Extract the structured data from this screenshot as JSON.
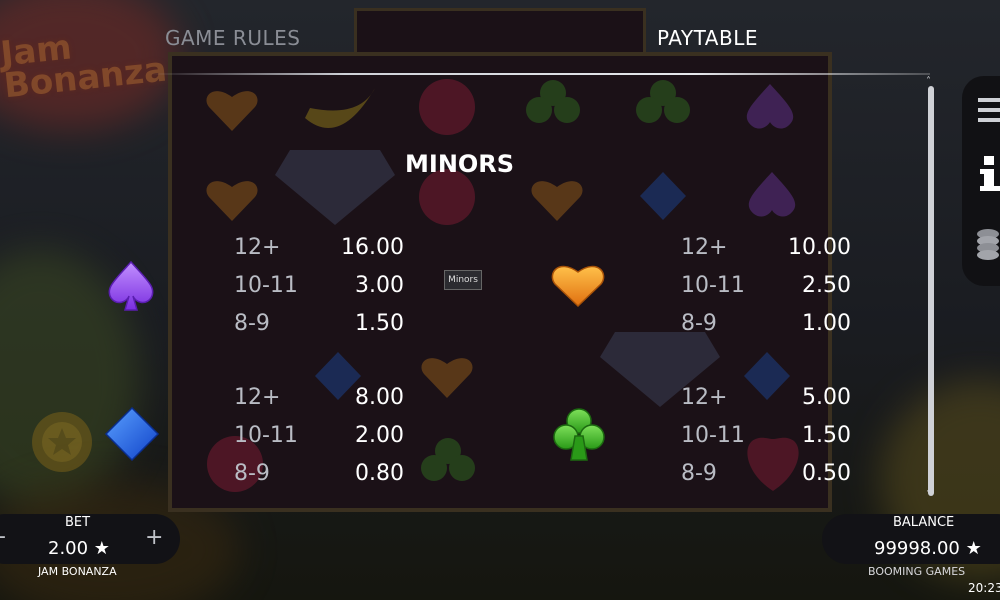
{
  "game": {
    "logo_text": "Jam Bonanza"
  },
  "tabs": [
    {
      "label": "GAME RULES",
      "active": false
    },
    {
      "label": "PAYTABLE",
      "active": true
    }
  ],
  "section": {
    "title": "MINORS",
    "tooltip": "Minors"
  },
  "paytable": [
    {
      "symbol": "spade-icon",
      "color": "#9b4ff0",
      "rows": [
        {
          "count": "12+",
          "value": "16.00"
        },
        {
          "count": "10-11",
          "value": "3.00"
        },
        {
          "count": "8-9",
          "value": "1.50"
        }
      ]
    },
    {
      "symbol": "heart-icon",
      "color": "#f59a1c",
      "rows": [
        {
          "count": "12+",
          "value": "10.00"
        },
        {
          "count": "10-11",
          "value": "2.50"
        },
        {
          "count": "8-9",
          "value": "1.00"
        }
      ]
    },
    {
      "symbol": "diamond-icon",
      "color": "#1e6cf0",
      "rows": [
        {
          "count": "12+",
          "value": "8.00"
        },
        {
          "count": "10-11",
          "value": "2.00"
        },
        {
          "count": "8-9",
          "value": "0.80"
        }
      ]
    },
    {
      "symbol": "club-icon",
      "color": "#3fb326",
      "rows": [
        {
          "count": "12+",
          "value": "5.00"
        },
        {
          "count": "10-11",
          "value": "1.50"
        },
        {
          "count": "8-9",
          "value": "0.50"
        }
      ]
    }
  ],
  "bet": {
    "label": "BET",
    "value": "2.00 ★",
    "game_name": "JAM BONANZA",
    "minus": "-",
    "plus": "+"
  },
  "balance": {
    "label": "BALANCE",
    "value": "99998.00 ★",
    "brand": "BOOMING GAMES"
  },
  "clock": "20:23",
  "scroll": {
    "up": "˄",
    "down": "˅"
  }
}
